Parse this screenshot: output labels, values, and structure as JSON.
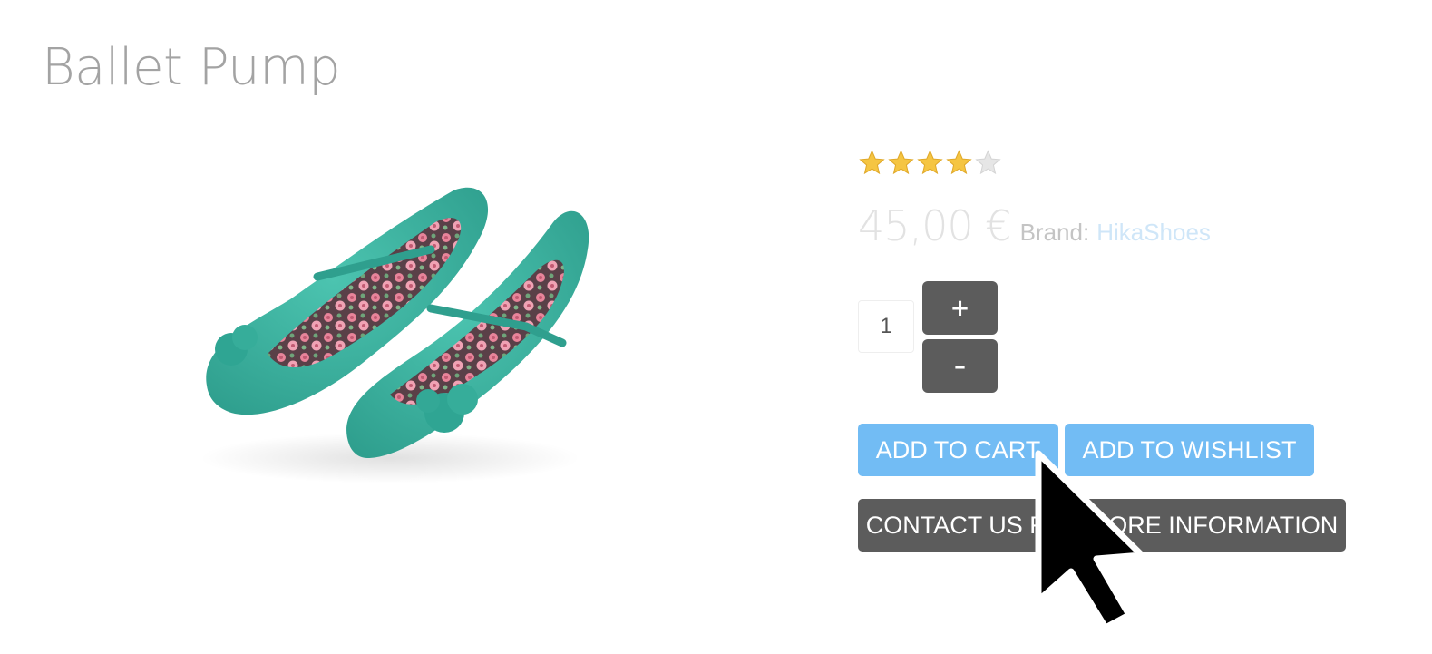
{
  "product": {
    "title": "Ballet Pump",
    "image_icon": "ballet-pump-shoes-image",
    "rating": {
      "value": 4,
      "max": 5
    },
    "price": "45,00 €",
    "brand_label": "Brand:",
    "brand_name": "HikaShoes"
  },
  "quantity": {
    "value": "1",
    "plus_label": "+",
    "minus_label": "–"
  },
  "actions": {
    "add_to_cart": "ADD TO CART",
    "add_to_wishlist": "ADD TO WISHLIST",
    "contact": "CONTACT US FOR MORE INFORMATION"
  },
  "colors": {
    "accent": "#72bcf4",
    "dark_button": "#5c5c5c",
    "title": "#a3a3a3",
    "shoe": "#3bb3a0",
    "star_filled": "#f5c542",
    "star_empty": "#dddddd"
  }
}
